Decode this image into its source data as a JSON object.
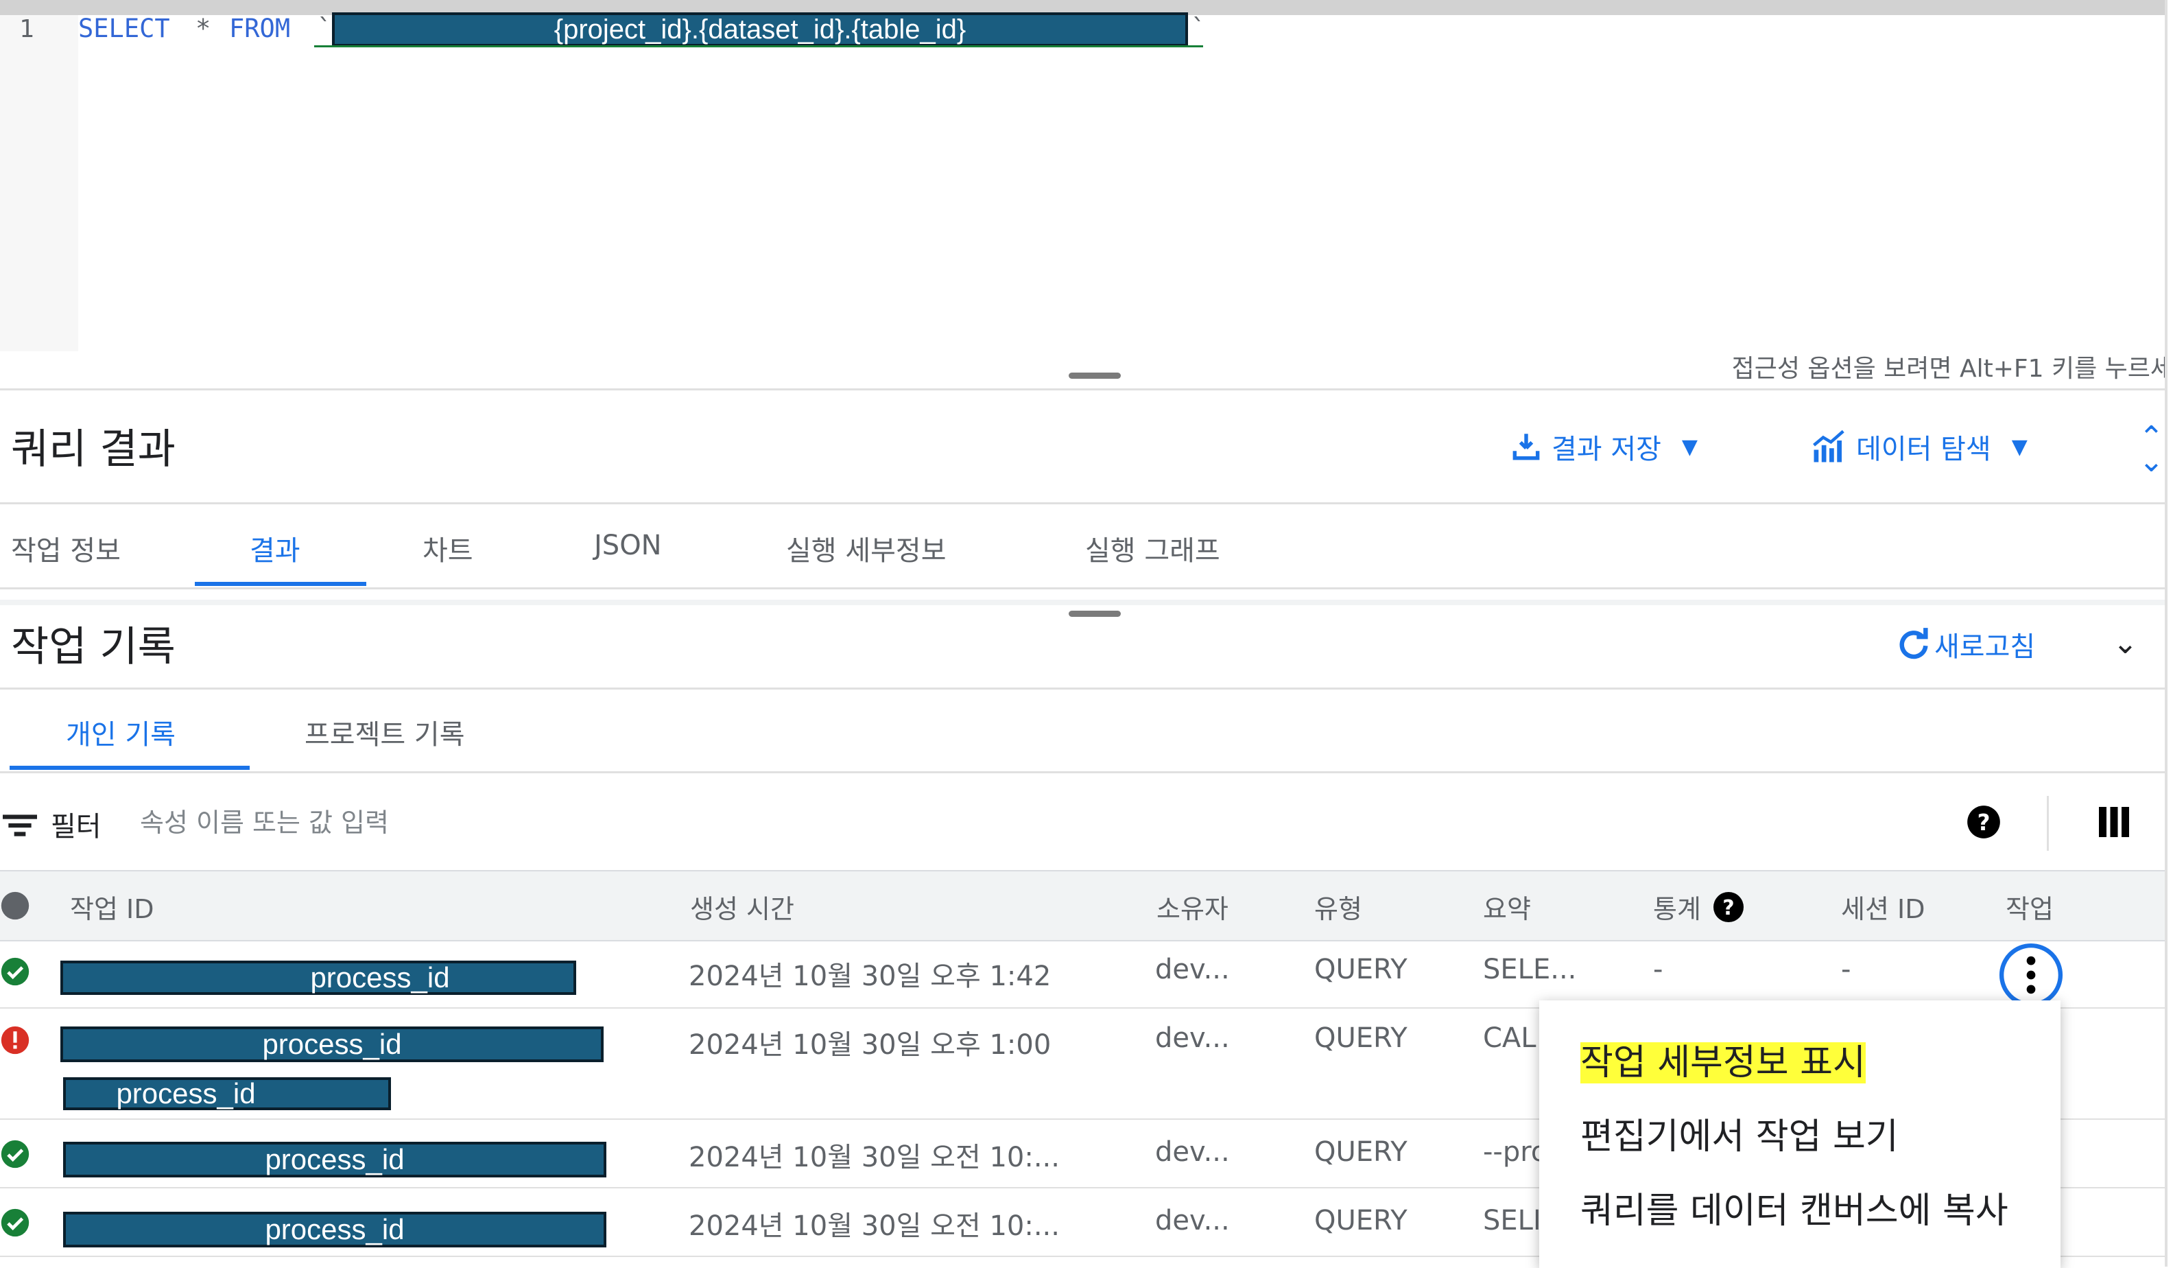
{
  "editor": {
    "line_number": "1",
    "kw_select": "SELECT",
    "star": "*",
    "kw_from": "FROM",
    "backtick_open": "`",
    "table_ref": "{project_id}.{dataset_id}.{table_id}",
    "backtick_close": "`",
    "accessibility_hint": "접근성 옵션을 보려면 Alt+F1 키를 누르세"
  },
  "results": {
    "title": "쿼리 결과",
    "save_label": "결과 저장",
    "explore_label": "데이터 탐색",
    "tabs": [
      "작업 정보",
      "결과",
      "차트",
      "JSON",
      "실행 세부정보",
      "실행 그래프"
    ],
    "active_tab": "결과"
  },
  "history": {
    "title": "작업 기록",
    "refresh_label": "새로고침",
    "tabs": [
      "개인 기록",
      "프로젝트 기록"
    ],
    "active_tab": "개인 기록",
    "filter_label": "필터",
    "filter_placeholder": "속성 이름 또는 값 입력",
    "columns": [
      "작업 ID",
      "생성 시간",
      "소유자",
      "유형",
      "요약",
      "통계",
      "세션 ID",
      "작업"
    ],
    "rows": [
      {
        "status": "success",
        "job_id": "process_id",
        "created": "2024년 10월 30일 오후 1:42",
        "owner": "dev...",
        "type": "QUERY",
        "summary": "SELE...",
        "stats": "-",
        "session": "-"
      },
      {
        "status": "error",
        "job_id": "process_id",
        "job_id_2": "process_id",
        "created": "2024년 10월 30일 오후 1:00",
        "owner": "dev...",
        "type": "QUERY",
        "summary": "CAL"
      },
      {
        "status": "success",
        "job_id": "process_id",
        "created": "2024년 10월 30일 오전 10:...",
        "owner": "dev...",
        "type": "QUERY",
        "summary": "--pro"
      },
      {
        "status": "success",
        "job_id": "process_id",
        "created": "2024년 10월 30일 오전 10:...",
        "owner": "dev...",
        "type": "QUERY",
        "summary": "SELI"
      }
    ]
  },
  "context_menu": {
    "items": [
      "작업 세부정보 표시",
      "편집기에서 작업 보기",
      "쿼리를 데이터 캔버스에 복사"
    ],
    "highlighted": "작업 세부정보 표시"
  },
  "colors": {
    "accent": "#1a73e8",
    "success": "#188038",
    "error": "#d93025",
    "redaction": "#1a5d80",
    "highlight": "#ffff3a"
  }
}
